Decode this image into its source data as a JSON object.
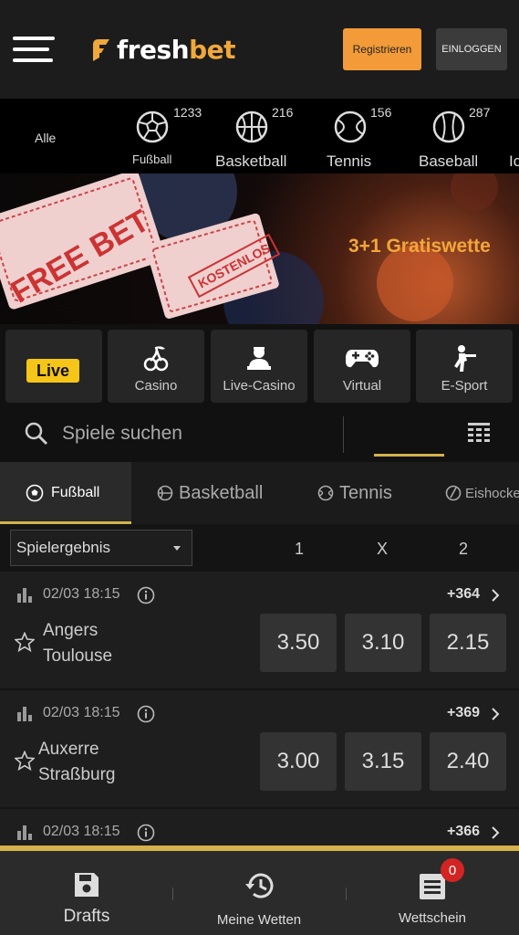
{
  "header": {
    "logo_fresh": "fresh",
    "logo_bet": "bet",
    "register_label": "Registrieren",
    "login_label": "EINLOGGEN"
  },
  "sports_bar": {
    "all_label": "Alle",
    "items": [
      {
        "label": "Fußball",
        "count": "1233",
        "icon": "soccer-ball-icon"
      },
      {
        "label": "Basketball",
        "count": "216",
        "icon": "basketball-icon"
      },
      {
        "label": "Tennis",
        "count": "156",
        "icon": "tennis-ball-icon"
      },
      {
        "label": "Baseball",
        "count": "287",
        "icon": "baseball-icon"
      },
      {
        "label": "Ic",
        "count": "",
        "icon": ""
      }
    ]
  },
  "banner": {
    "ticket1": "FREE BET",
    "ticket2": "KOSTENLOS",
    "headline": "3+1 Gratiswette"
  },
  "quick_tiles": [
    {
      "label": "Live",
      "icon": "live-badge"
    },
    {
      "label": "Casino",
      "icon": "cherries-icon"
    },
    {
      "label": "Live-Casino",
      "icon": "dealer-icon"
    },
    {
      "label": "Virtual",
      "icon": "gamepad-icon"
    },
    {
      "label": "E-Sport",
      "icon": "soldier-icon"
    }
  ],
  "search": {
    "placeholder": "Spiele suchen"
  },
  "sport_tabs": [
    {
      "label": "Fußball",
      "active": true
    },
    {
      "label": "Basketball",
      "active": false
    },
    {
      "label": "Tennis",
      "active": false
    },
    {
      "label": "Eishockey",
      "active": false
    }
  ],
  "market": {
    "selected": "Spielergebnis",
    "columns": [
      "1",
      "X",
      "2"
    ]
  },
  "matches": [
    {
      "datetime": "02/03 18:15",
      "more": "+364",
      "home": "Angers",
      "away": "Toulouse",
      "odds": [
        "3.50",
        "3.10",
        "2.15"
      ]
    },
    {
      "datetime": "02/03 18:15",
      "more": "+369",
      "home": "Auxerre",
      "away": "Straßburg",
      "odds": [
        "3.00",
        "3.15",
        "2.40"
      ]
    },
    {
      "datetime": "02/03 18:15",
      "more": "+366",
      "home": "",
      "away": "",
      "odds": []
    }
  ],
  "bottom_nav": {
    "drafts_label": "Drafts",
    "mybets_label": "Meine Wetten",
    "betslip_label": "Wettschein",
    "betslip_count": "0"
  },
  "colors": {
    "accent_orange": "#f29b38",
    "accent_gold": "#d4b24c",
    "live_yellow": "#f5c518",
    "badge_red": "#d32424"
  }
}
